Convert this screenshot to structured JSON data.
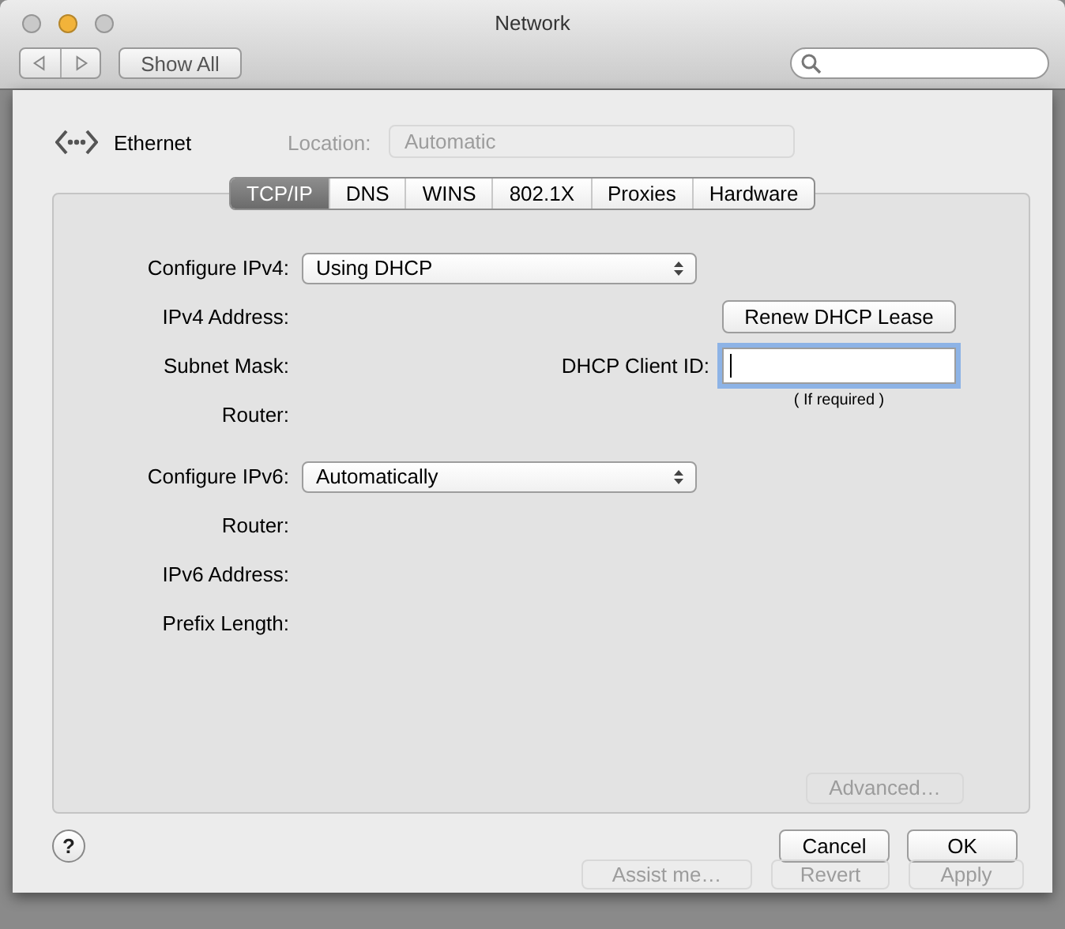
{
  "window": {
    "title": "Network",
    "traffic_lights": [
      {
        "color": "#c9c9c9"
      },
      {
        "color": "#f2b33a"
      },
      {
        "color": "#c9c9c9"
      }
    ]
  },
  "toolbar": {
    "show_all_button": "Show All"
  },
  "service": {
    "name": "Ethernet"
  },
  "background": {
    "location_label": "Location:",
    "location_value": "Automatic",
    "advanced_button": "Advanced…",
    "bottom_buttons": [
      "Assist me…",
      "Revert",
      "Apply"
    ]
  },
  "tabs": [
    {
      "label": "TCP/IP",
      "selected": true
    },
    {
      "label": "DNS",
      "selected": false
    },
    {
      "label": "WINS",
      "selected": false
    },
    {
      "label": "802.1X",
      "selected": false
    },
    {
      "label": "Proxies",
      "selected": false
    },
    {
      "label": "Hardware",
      "selected": false
    }
  ],
  "ipv4": {
    "configure_label": "Configure IPv4:",
    "configure_value": "Using DHCP",
    "field_labels": [
      "IPv4 Address:",
      "Subnet Mask:",
      "Router:"
    ]
  },
  "dhcp": {
    "renew_button": "Renew DHCP Lease",
    "client_id_label": "DHCP Client ID:",
    "client_id_focused": true,
    "client_id_note": "( If required )"
  },
  "ipv6": {
    "configure_label": "Configure IPv6:",
    "configure_value": "Automatically",
    "field_labels": [
      "Router:",
      "IPv6 Address:",
      "Prefix Length:"
    ]
  },
  "footer": {
    "help_button": "?",
    "buttons": [
      "Cancel",
      "OK"
    ]
  }
}
